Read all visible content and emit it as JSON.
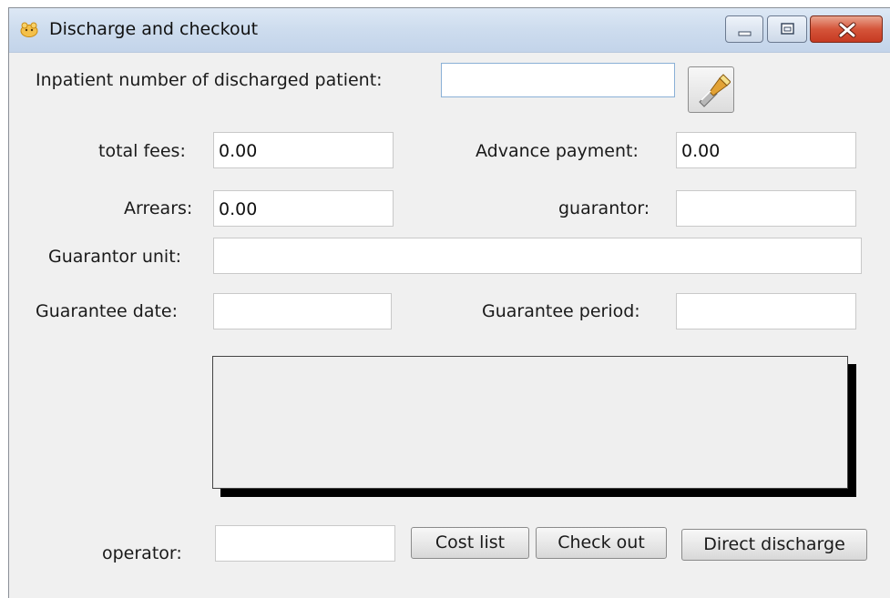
{
  "window": {
    "title": "Discharge and checkout"
  },
  "form": {
    "inpatient_label": "Inpatient number of discharged patient:",
    "inpatient_value": "",
    "total_fees_label": "total fees:",
    "total_fees_value": "0.00",
    "advance_payment_label": "Advance payment:",
    "advance_payment_value": "0.00",
    "arrears_label": "Arrears:",
    "arrears_value": "0.00",
    "guarantor_label": "guarantor:",
    "guarantor_value": "",
    "guarantor_unit_label": "Guarantor unit:",
    "guarantor_unit_value": "",
    "guarantee_date_label": "Guarantee date:",
    "guarantee_date_value": "",
    "guarantee_period_label": "Guarantee period:",
    "guarantee_period_value": "",
    "operator_label": "operator:",
    "operator_value": ""
  },
  "buttons": {
    "cost_list": "Cost list",
    "check_out": "Check out",
    "direct_discharge": "Direct discharge"
  },
  "icons": {
    "app": "app-icon",
    "lookup": "flashlight-search-icon",
    "minimize": "minimize-icon",
    "maximize": "maximize-icon",
    "close": "close-icon"
  },
  "colors": {
    "titlebar": "#cddcee",
    "window_bg": "#f0f0f0",
    "close_button": "#d5553a"
  }
}
